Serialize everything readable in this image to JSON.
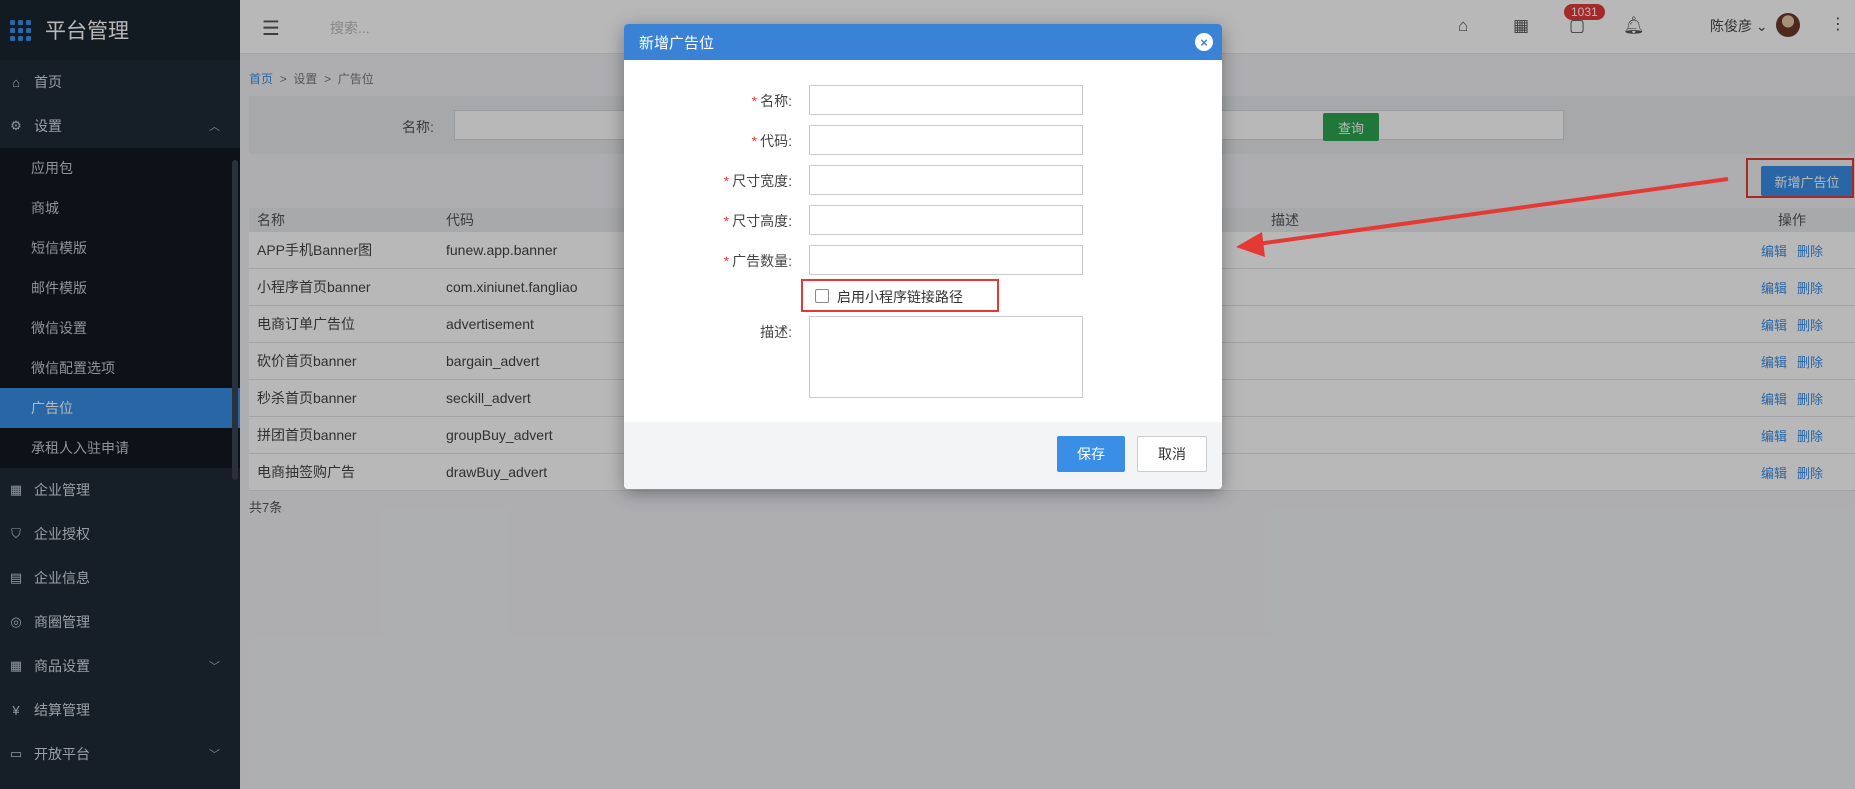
{
  "app": {
    "title": "平台管理"
  },
  "sidebar": {
    "items": [
      {
        "label": "首页",
        "icon": "home-icon"
      },
      {
        "label": "设置",
        "icon": "gear-icon",
        "expanded": true
      }
    ],
    "sub_items": [
      {
        "label": "应用包"
      },
      {
        "label": "商城"
      },
      {
        "label": "短信模版"
      },
      {
        "label": "邮件模版"
      },
      {
        "label": "微信设置"
      },
      {
        "label": "微信配置选项"
      },
      {
        "label": "广告位",
        "active": true
      },
      {
        "label": "承租人入驻申请"
      }
    ],
    "bottom_items": [
      {
        "label": "企业管理",
        "icon": "grid-icon"
      },
      {
        "label": "企业授权",
        "icon": "shield-icon"
      },
      {
        "label": "企业信息",
        "icon": "news-icon"
      },
      {
        "label": "商圈管理",
        "icon": "compass-icon"
      },
      {
        "label": "商品设置",
        "icon": "grid-icon",
        "has_caret": true
      },
      {
        "label": "结算管理",
        "icon": "yen-icon"
      },
      {
        "label": "开放平台",
        "icon": "monitor-icon",
        "has_caret": true
      }
    ]
  },
  "header": {
    "search_placeholder": "搜索...",
    "badge_count": "1031",
    "user_name": "陈俊彦"
  },
  "breadcrumb": {
    "home": "首页",
    "sep": ">",
    "level1": "设置",
    "level2": "广告位"
  },
  "filter": {
    "name_label": "名称:",
    "query_button": "查询"
  },
  "toolbar": {
    "new_button": "新增广告位"
  },
  "table": {
    "headers": {
      "name": "名称",
      "code": "代码",
      "desc": "描述",
      "ops": "操作"
    },
    "rows": [
      {
        "name": "APP手机Banner图",
        "code": "funew.app.banner",
        "desc": ""
      },
      {
        "name": "小程序首页banner",
        "code": "com.xiniunet.fangliao",
        "desc": ""
      },
      {
        "name": "电商订单广告位",
        "code": "advertisement",
        "desc": ""
      },
      {
        "name": "砍价首页banner",
        "code": "bargain_advert",
        "desc": ""
      },
      {
        "name": "秒杀首页banner",
        "code": "seckill_advert",
        "desc": ""
      },
      {
        "name": "拼团首页banner",
        "code": "groupBuy_advert",
        "desc": ""
      },
      {
        "name": "电商抽签购广告",
        "code": "drawBuy_advert",
        "desc": ""
      }
    ],
    "edit_label": "编辑",
    "delete_label": "删除",
    "total": "共7条"
  },
  "modal": {
    "title": "新增广告位",
    "fields": [
      {
        "label": "名称:",
        "required": true,
        "value": ""
      },
      {
        "label": "代码:",
        "required": true,
        "value": ""
      },
      {
        "label": "尺寸宽度:",
        "required": true,
        "value": ""
      },
      {
        "label": "尺寸高度:",
        "required": true,
        "value": ""
      },
      {
        "label": "广告数量:",
        "required": true,
        "value": ""
      }
    ],
    "checkbox_label": "启用小程序链接路径",
    "desc_label": "描述:",
    "save_button": "保存",
    "cancel_button": "取消"
  },
  "colors": {
    "sidebar_bg": "#1f2b38",
    "accent": "#3a8ee6",
    "query_green": "#2ea44f",
    "highlight_red": "#e53935"
  }
}
